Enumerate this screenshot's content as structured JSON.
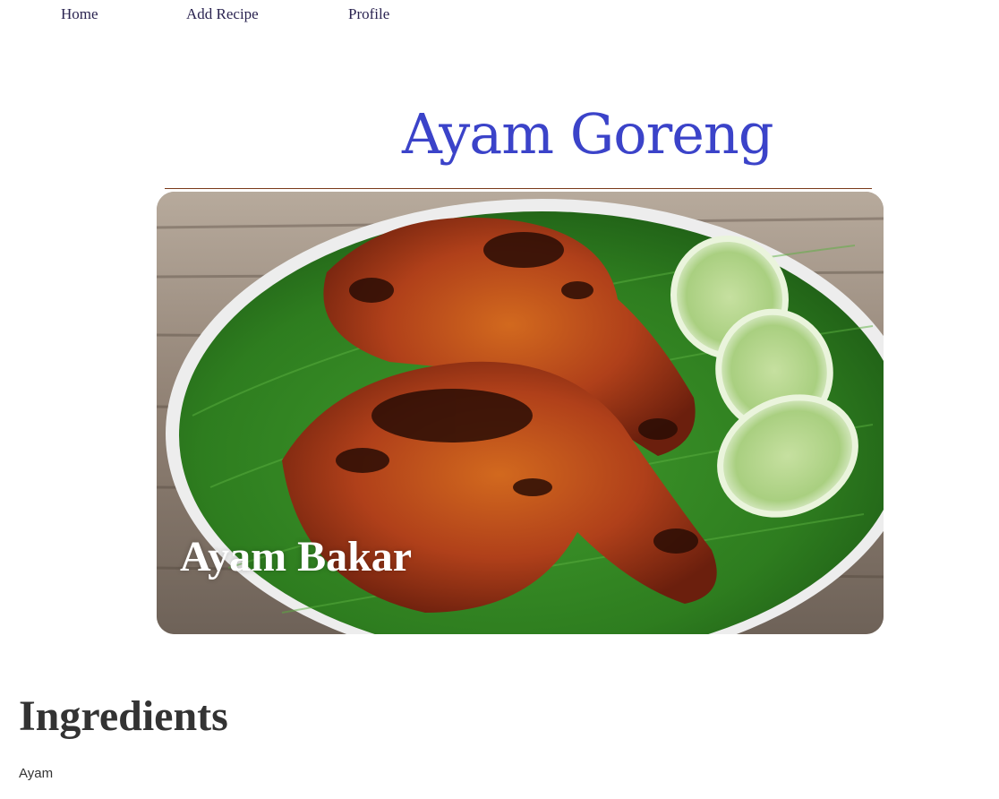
{
  "nav": {
    "items": [
      {
        "label": "Home"
      },
      {
        "label": "Add Recipe"
      },
      {
        "label": "Profile"
      }
    ]
  },
  "recipe": {
    "title": "Ayam Goreng",
    "image_caption": "Ayam Bakar",
    "ingredients_heading": "Ingredients",
    "ingredients": [
      "Ayam"
    ]
  },
  "colors": {
    "title": "#3b43c9",
    "nav_text": "#2a2350",
    "heading_text": "#333333"
  }
}
